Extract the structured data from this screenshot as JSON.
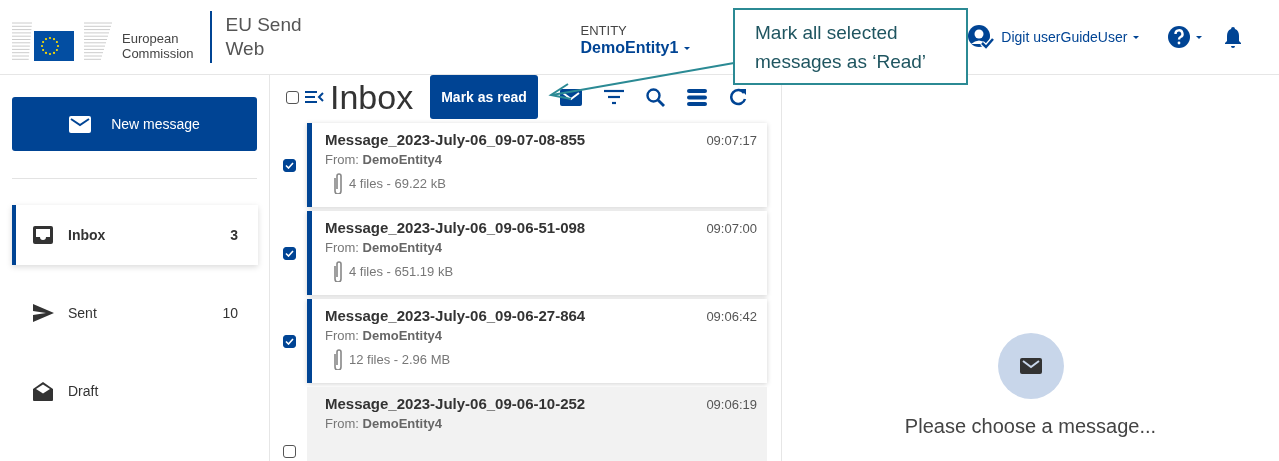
{
  "header": {
    "logo_text": [
      "European",
      "Commission"
    ],
    "app_title": [
      "EU Send",
      "Web"
    ],
    "entity_label": "ENTITY",
    "entity_name": "DemoEntity1",
    "user_name": "Digit userGuideUser"
  },
  "callout": {
    "text": [
      "Mark all selected",
      "messages as ‘Read’"
    ]
  },
  "sidebar": {
    "new_button": "New message",
    "items": [
      {
        "kind": "inbox",
        "label": "Inbox",
        "count": "3",
        "selected": true
      },
      {
        "kind": "sent",
        "label": "Sent",
        "count": "10",
        "selected": false
      },
      {
        "kind": "draft",
        "label": "Draft",
        "selected": false
      }
    ]
  },
  "list": {
    "title": "Inbox",
    "select_all_checked": false,
    "mark_read_button": "Mark as read",
    "messages": [
      {
        "subject": "Message_2023-July-06_09-07-08-855",
        "time": "09:07:17",
        "from": "From: **DemoEntity4**",
        "attachments": "4 files - 69.22 kB",
        "checked": true
      },
      {
        "subject": "Message_2023-July-06_09-06-51-098",
        "time": "09:07:00",
        "from": "From: **DemoEntity4**",
        "attachments": "4 files - 651.19 kB",
        "checked": true
      },
      {
        "subject": "Message_2023-July-06_09-06-27-864",
        "time": "09:06:42",
        "from": "From: **DemoEntity4**",
        "attachments": "12 files - 2.96 MB",
        "checked": true
      },
      {
        "subject": "Message_2023-July-06_09-06-10-252",
        "time": "09:06:19",
        "from": "From: **DemoEntity4**",
        "checked": false
      }
    ]
  },
  "detail": {
    "empty_text": "Please choose a message..."
  }
}
